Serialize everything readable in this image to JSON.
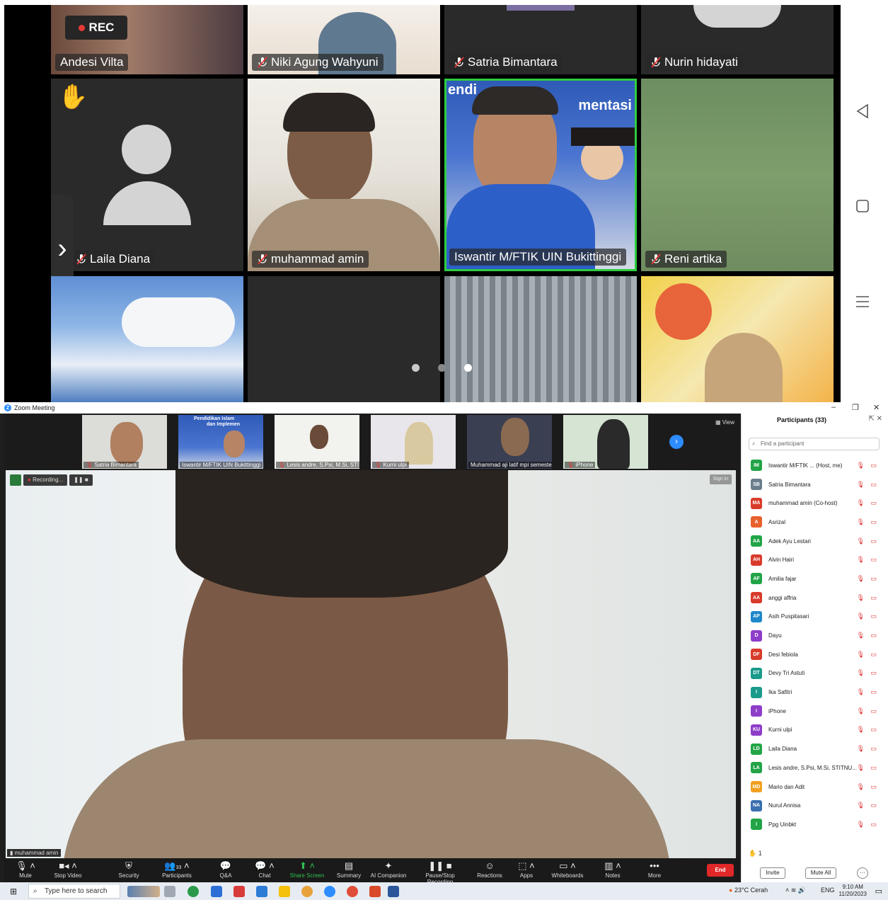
{
  "phone": {
    "rec_label": "REC",
    "tiles": [
      {
        "name": "Andesi Vilta"
      },
      {
        "name": "Niki Agung Wahyuni"
      },
      {
        "name": "Satria Bimantara"
      },
      {
        "name": "Nurin hidayati"
      },
      {
        "name": "Laila Diana"
      },
      {
        "name": "muhammad amin"
      },
      {
        "name": "Iswantir M/FTIK UIN Bukittinggi"
      },
      {
        "name": "Reni artika"
      }
    ],
    "banner_text_1": "endi",
    "banner_text_2": "mentasi"
  },
  "zoom": {
    "window_title": "Zoom Meeting",
    "strip": {
      "view_label": "View",
      "thumbs": [
        {
          "name": "Satria Bimantara"
        },
        {
          "name": "Iswantir M/FTIK UIN Bukittinggi"
        },
        {
          "name": "Lesis andre, S.Psi, M.Si, STITN..."
        },
        {
          "name": "Kurni ulpi"
        },
        {
          "name": "Muhammad aji latif mpi semeste..."
        },
        {
          "name": "iPhone"
        }
      ],
      "thumb_banner": "Pendidikan Islam",
      "thumb_banner_2": "dan Implemen"
    },
    "main": {
      "recording_label": "Recording...",
      "sign_in_label": "Sign in",
      "speaker_name": "muhammad amin"
    },
    "toolbar": {
      "mute": "Mute",
      "stop_video": "Stop Video",
      "security": "Security",
      "participants": "Participants",
      "participants_count": "33",
      "qa": "Q&A",
      "chat": "Chat",
      "share_screen": "Share Screen",
      "summary": "Summary",
      "ai_companion": "AI Companion",
      "pause_recording": "Pause/Stop Recording",
      "reactions": "Reactions",
      "apps": "Apps",
      "whiteboards": "Whiteboards",
      "notes": "Notes",
      "more": "More",
      "end": "End"
    },
    "panel": {
      "title": "Participants (33)",
      "search_placeholder": "Find a participant",
      "raised_hands": "1",
      "invite": "Invite",
      "mute_all": "Mute All",
      "participants": [
        {
          "initials": "IM",
          "name": "Iswantir M/FTIK ... (Host, me)",
          "color": "#22a447"
        },
        {
          "initials": "SB",
          "name": "Satria Bimantara",
          "color": "#6a7d8c"
        },
        {
          "initials": "MA",
          "name": "muhammad amin (Co-host)",
          "color": "#d93b2b"
        },
        {
          "initials": "A",
          "name": "Asrizal",
          "color": "#e8612c"
        },
        {
          "initials": "AA",
          "name": "Adek Ayu Lestari",
          "color": "#22a447"
        },
        {
          "initials": "AH",
          "name": "Alvin Hairi",
          "color": "#d93b2b"
        },
        {
          "initials": "AF",
          "name": "Amilia fajar",
          "color": "#22a447"
        },
        {
          "initials": "AA",
          "name": "anggi affria",
          "color": "#d93b2b"
        },
        {
          "initials": "AP",
          "name": "Asih Puspitasari",
          "color": "#1e88c9"
        },
        {
          "initials": "D",
          "name": "Dayu",
          "color": "#8e3dc8"
        },
        {
          "initials": "DF",
          "name": "Desi febiola",
          "color": "#d93b2b"
        },
        {
          "initials": "DT",
          "name": "Devy Tri Astuti",
          "color": "#1a9a8a"
        },
        {
          "initials": "I",
          "name": "Ika Safitri",
          "color": "#1a9a8a"
        },
        {
          "initials": "I",
          "name": "iPhone",
          "color": "#8e3dc8"
        },
        {
          "initials": "KU",
          "name": "Kurni ulpi",
          "color": "#8e3dc8"
        },
        {
          "initials": "LD",
          "name": "Laila Diana",
          "color": "#22a447"
        },
        {
          "initials": "LA",
          "name": "Lesis andre, S.Psi, M.Si, STITNU...",
          "color": "#22a447"
        },
        {
          "initials": "MD",
          "name": "Mario dan Adit",
          "color": "#f0a020"
        },
        {
          "initials": "NA",
          "name": "Nurul Annisa",
          "color": "#3a6fb0"
        },
        {
          "initials": "I",
          "name": "Ppg Uinbkt",
          "color": "#22a447"
        }
      ]
    },
    "taskbar": {
      "search_placeholder": "Type here to search",
      "weather": "23°C Cerah",
      "language": "ENG",
      "time": "9:10 AM",
      "date": "11/20/2023"
    }
  }
}
